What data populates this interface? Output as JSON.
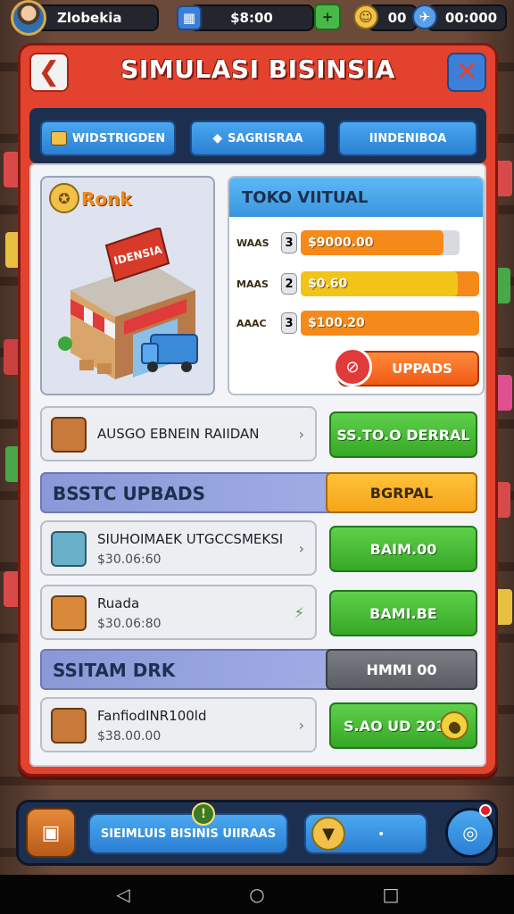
{
  "topbar": {
    "player_name": "Zlobekia",
    "money": "$8:00",
    "gems": "00",
    "coins": "00:000"
  },
  "header": {
    "title": "SIMULASI BISINSIA"
  },
  "tabs": [
    {
      "label": "WIDSTRIGDEN"
    },
    {
      "label": "SAGRISRAA"
    },
    {
      "label": "IINDENIBOA"
    }
  ],
  "rank_card": {
    "label": "Ronk",
    "store_sign": "IDENSIA"
  },
  "toko": {
    "title": "TOKO VIITUAL",
    "stats": [
      {
        "label": "WAAS",
        "level": "3",
        "value": "$9000.00",
        "fill": 0.9,
        "color": "#f58a1a"
      },
      {
        "label": "MAAS",
        "level": "2",
        "value": "$0.60",
        "fill": 0.88,
        "color": "#f2c418"
      },
      {
        "label": "AAAC",
        "level": "3",
        "value": "$100.20",
        "fill": 1.0,
        "color": "#f58a1a"
      }
    ],
    "upgrade_label": "UPPADS"
  },
  "rows": {
    "audit": {
      "title": "AUSGO EBNEIN RAIIDAN",
      "button": "SS.TO.O DERRAL"
    },
    "section_upgrades": {
      "title": "BSSTC UPBADS",
      "button": "BGRPAL"
    },
    "item1": {
      "title": "SIUHOIMAEK UTGCCSMEKSI",
      "sub": "$30.06:60",
      "button": "BAIM.00"
    },
    "item2": {
      "title": "Ruada",
      "sub": "$30.06:80",
      "button": "BAMI.BE"
    },
    "section_system": {
      "title": "SSITAM DRK",
      "button": "HMMI 00"
    },
    "item3": {
      "title": "FanfiodINR100ld",
      "sub": "$38.00.00",
      "button": "S.AO UD 2013"
    }
  },
  "bottom": {
    "main_label": "SIEIMLUIS BISINIS UIIRAAS",
    "badge": "!"
  },
  "colors": {
    "panel_red": "#e3422e",
    "tab_blue": "#3a95df",
    "button_green": "#36a826",
    "button_orange": "#f05a14",
    "section_purple": "#8a98d8",
    "section_yellow": "#f5b52a",
    "section_gray": "#6a6d74"
  },
  "icons": {
    "avatar": "player-avatar",
    "money": "money-icon",
    "gems": "gem-icon",
    "coins": "coin-icon",
    "back": "back-arrow-icon",
    "close": "close-icon"
  }
}
